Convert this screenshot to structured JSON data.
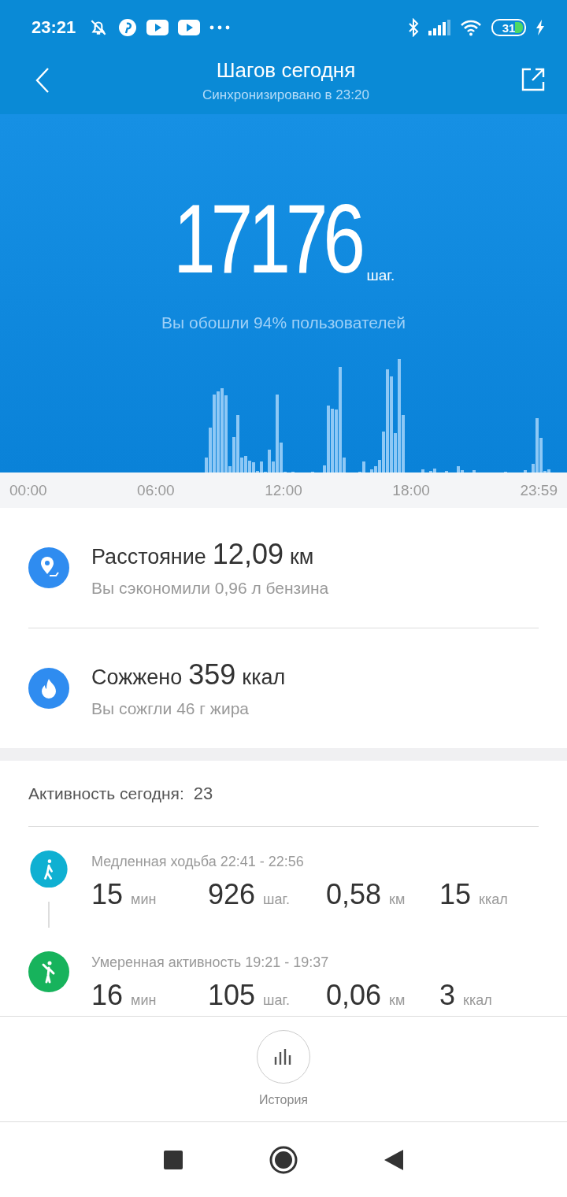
{
  "status_bar": {
    "time": "23:21",
    "battery": "31"
  },
  "header": {
    "title": "Шагов сегодня",
    "subtitle": "Синхронизировано в 23:20"
  },
  "summary": {
    "steps": "17176",
    "unit": "шаг.",
    "comparison": "Вы обошли 94% пользователей"
  },
  "chart": {
    "time_labels": [
      "00:00",
      "06:00",
      "12:00",
      "18:00",
      "23:59"
    ]
  },
  "stats": [
    {
      "kind": "distance",
      "label": "Расстояние",
      "value": "12,09",
      "unit": "км",
      "note": "Вы сэкономили 0,96 л бензина"
    },
    {
      "kind": "calories",
      "label": "Сожжено",
      "value": "359",
      "unit": "ккал",
      "note": "Вы сожгли 46 г жира"
    }
  ],
  "activity": {
    "label": "Активность сегодня:",
    "count": "23",
    "sessions": [
      {
        "kind": "walk",
        "color": "#0fb0d2",
        "title": "Медленная ходьба 22:41 - 22:56",
        "metrics": [
          {
            "value": "15",
            "unit": "мин"
          },
          {
            "value": "926",
            "unit": "шаг."
          },
          {
            "value": "0,58",
            "unit": "км"
          },
          {
            "value": "15",
            "unit": "ккал"
          }
        ]
      },
      {
        "kind": "moderate",
        "color": "#17b35c",
        "title": "Умеренная активность 19:21 - 19:37",
        "metrics": [
          {
            "value": "16",
            "unit": "мин"
          },
          {
            "value": "105",
            "unit": "шаг."
          },
          {
            "value": "0,06",
            "unit": "км"
          },
          {
            "value": "3",
            "unit": "ккал"
          }
        ]
      }
    ]
  },
  "bottom": {
    "history_label": "История"
  }
}
